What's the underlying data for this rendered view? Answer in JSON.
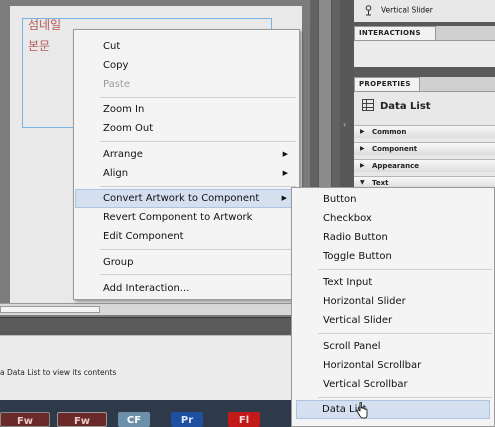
{
  "artboard": {
    "thumbnail_text": "섬네일",
    "body_text": "본문"
  },
  "bottom_panel": {
    "hint": "a Data List to view its contents"
  },
  "taskbar": {
    "items": [
      "Fw",
      "Fw",
      "CF",
      "Pr",
      "Fl"
    ]
  },
  "components_panel": {
    "visible_item": "Vertical Slider"
  },
  "interactions_panel": {
    "tab": "INTERACTIONS"
  },
  "properties_panel": {
    "tab": "PROPERTIES",
    "title": "Data List",
    "sections": [
      "Common",
      "Component",
      "Appearance",
      "Text"
    ]
  },
  "context_menu": {
    "cut": "Cut",
    "copy": "Copy",
    "paste": "Paste",
    "zoom_in": "Zoom In",
    "zoom_out": "Zoom Out",
    "arrange": "Arrange",
    "align": "Align",
    "convert": "Convert Artwork to Component",
    "revert": "Revert Component to Artwork",
    "edit": "Edit Component",
    "group": "Group",
    "add_interaction": "Add Interaction..."
  },
  "submenu": {
    "button": "Button",
    "checkbox": "Checkbox",
    "radio_button": "Radio Button",
    "toggle_button": "Toggle Button",
    "text_input": "Text Input",
    "horizontal_slider": "Horizontal Slider",
    "vertical_slider": "Vertical Slider",
    "scroll_panel": "Scroll Panel",
    "horizontal_scrollbar": "Horizontal Scrollbar",
    "vertical_scrollbar": "Vertical Scrollbar",
    "data_list": "Data List"
  },
  "colors": {
    "highlight": "#d4dff0",
    "artboard_text": "#b65858",
    "selection": "#77b4e8"
  }
}
